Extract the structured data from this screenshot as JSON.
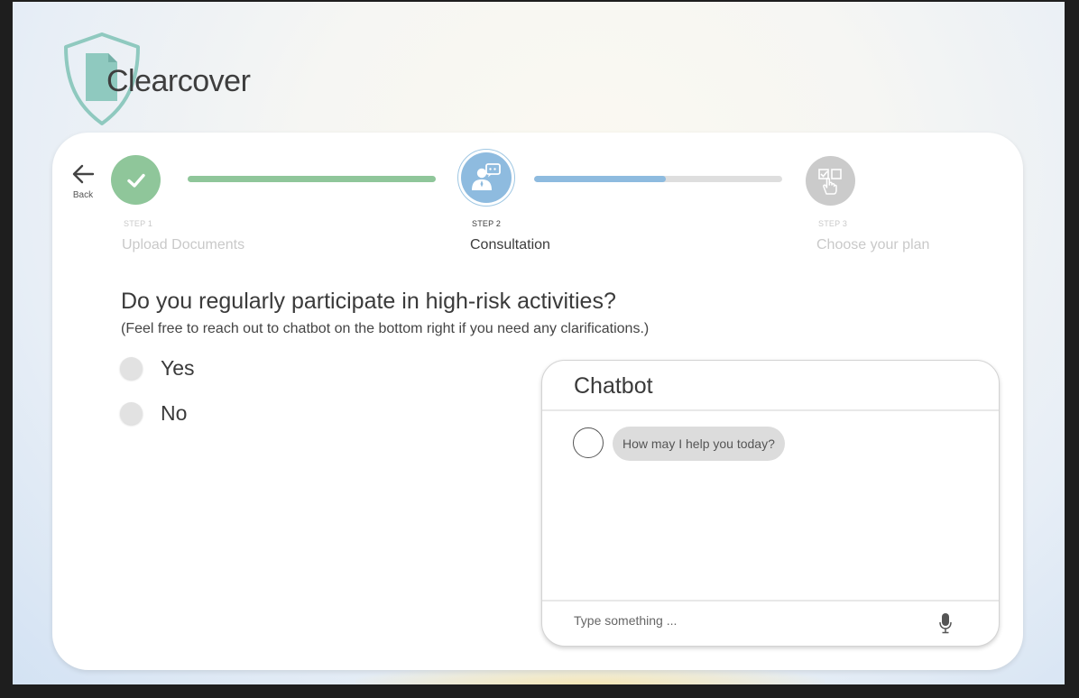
{
  "brand": {
    "name": "Clearcover"
  },
  "nav": {
    "back_label": "Back"
  },
  "steps": [
    {
      "tag": "STEP 1",
      "name": "Upload Documents",
      "state": "complete",
      "icon": "check-icon"
    },
    {
      "tag": "STEP 2",
      "name": "Consultation",
      "state": "active",
      "icon": "consultant-icon"
    },
    {
      "tag": "STEP 3",
      "name": "Choose your plan",
      "state": "upcoming",
      "icon": "select-plan-icon"
    }
  ],
  "progress": {
    "step1_to_step2": 1.0,
    "step2_to_step3": 0.53
  },
  "question": {
    "title": "Do you regularly participate in high-risk activities?",
    "hint": "(Feel free to reach out to chatbot on the bottom right if you need any clarifications.)",
    "options": [
      "Yes",
      "No"
    ]
  },
  "chatbot": {
    "title": "Chatbot",
    "messages": [
      {
        "sender": "bot",
        "text": "How may I help you today?"
      }
    ],
    "input_placeholder": "Type something ...",
    "mic_icon": "microphone-icon"
  },
  "colors": {
    "complete": "#8fc69a",
    "active": "#8ebbdf",
    "inactive": "#cbcbcb",
    "logo_shield": "#8fc9bf"
  }
}
